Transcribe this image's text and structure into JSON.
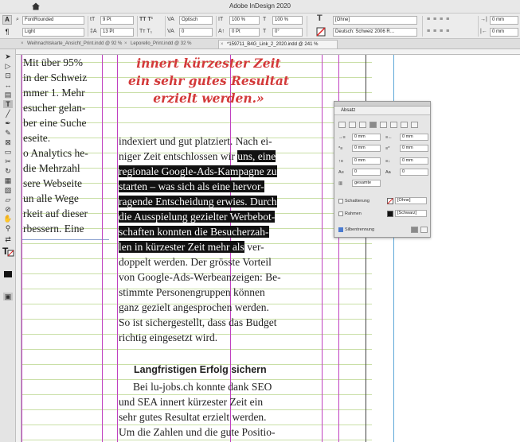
{
  "app": {
    "title": "Adobe InDesign 2020"
  },
  "control_bar": {
    "font_family": "FontRounded",
    "font_style": "Light",
    "font_size": "9 Pt",
    "leading": "13 Pt",
    "kerning": "Optisch",
    "tracking": "0",
    "vscale": "100 %",
    "hscale": "100 %",
    "baseline": "0 Pt",
    "skew": "0°",
    "char_style": "[Ohne]",
    "language": "Deutsch: Schweiz 2006 R…",
    "indent_left": "0 mm",
    "indent_right": "0 mm"
  },
  "tabs": [
    {
      "label": "Weihnachtskarte_Ansicht_Print.indd @ 92 %"
    },
    {
      "label": "Leporello_Print.indd @ 32 %"
    },
    {
      "label": "*159711_B4G_Link_2_2020.indd @ 241 %",
      "active": true
    }
  ],
  "tools": [
    "selection",
    "direct-select",
    "page",
    "gap",
    "content-collector",
    "type",
    "line",
    "pen",
    "pencil",
    "rectangle-frame",
    "rectangle",
    "scissors",
    "free-transform",
    "gradient-swatch",
    "gradient-feather",
    "note",
    "eyedropper",
    "hand",
    "zoom",
    "fill-stroke",
    "apply-color",
    "screen-mode"
  ],
  "left_column": [
    "Mit über 95%",
    "in der Schweiz",
    "mmer 1. Mehr",
    "esucher gelan-",
    "ber eine Suche",
    "eseite.",
    "o Analytics he-",
    "die Mehrzahl",
    "sere Webseite",
    "un alle Wege",
    "rkeit auf dieser",
    "rbessern. Eine"
  ],
  "quote_lines": [
    "innert kürzester Zeit",
    "ein sehr gutes Resultat",
    "erzielt werden.»"
  ],
  "body_lines": [
    {
      "pre": "indexiert und gut platziert. Nach ei-",
      "hl": "",
      "post": ""
    },
    {
      "pre": "niger Zeit entschlossen wir ",
      "hl": "uns, eine",
      "post": ""
    },
    {
      "pre": "",
      "hl": "regionale Google-Ads-Kampagne zu",
      "post": ""
    },
    {
      "pre": "",
      "hl": "starten – was sich als eine hervor-",
      "post": ""
    },
    {
      "pre": "",
      "hl": "ragende Entscheidung erwies. Durch",
      "post": ""
    },
    {
      "pre": "",
      "hl": "die Ausspielung gezielter Werbebot-",
      "post": ""
    },
    {
      "pre": "",
      "hl": "schaften konnten die Besucherzah-",
      "post": ""
    },
    {
      "pre": "",
      "hl": "len in kürzester Zeit mehr als",
      "post": " ver-"
    },
    {
      "pre": "doppelt werden. Der grösste Vorteil",
      "hl": "",
      "post": ""
    },
    {
      "pre": "von Google-Ads-Werbeanzeigen: Be-",
      "hl": "",
      "post": ""
    },
    {
      "pre": "stimmte Personengruppen können",
      "hl": "",
      "post": ""
    },
    {
      "pre": "ganz gezielt angesprochen werden.",
      "hl": "",
      "post": ""
    },
    {
      "pre": "So ist sichergestellt, dass das Budget",
      "hl": "",
      "post": ""
    },
    {
      "pre": "richtig eingesetzt wird.",
      "hl": "",
      "post": ""
    }
  ],
  "subheading": "Langfristigen Erfolg sichern",
  "body2_lines": [
    "Bei lu-jobs.ch konnte dank SEO",
    "und SEA innert kürzester Zeit ein",
    "sehr gutes Resultat erzielt werden.",
    "Um die Zahlen und die gute Positio-"
  ],
  "paragraph_panel": {
    "title": "Absatz",
    "indent_left": "0 mm",
    "indent_right": "0 mm",
    "first_line": "0 mm",
    "last_line": "0 mm",
    "space_before": "0 mm",
    "space_after": "0 mm",
    "drop_lines": "0",
    "drop_chars": "0",
    "hyphenate_zone": "gesamte",
    "shading_label": "Schattierung",
    "shading_value": "[Ohne]",
    "border_label": "Rahmen",
    "border_value": "[Schwarz]",
    "hyphenation_label": "Silbentrennung"
  }
}
